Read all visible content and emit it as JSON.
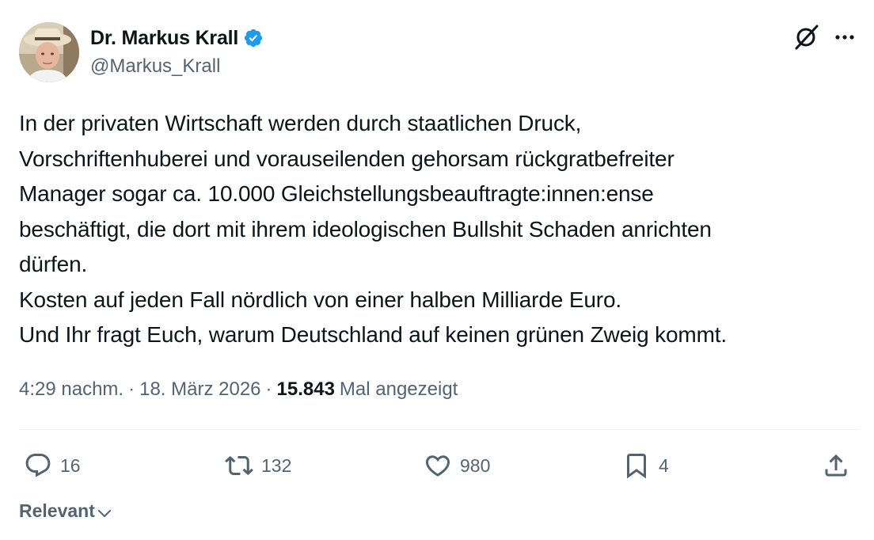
{
  "author": {
    "name": "Dr. Markus Krall",
    "handle": "@Markus_Krall",
    "verified": true
  },
  "tweet": {
    "text": "In der privaten Wirtschaft werden durch staatlichen Druck,\nVorschriftenhuberei und vorauseilenden gehorsam rückgratbefreiter\nManager sogar ca. 10.000 Gleichstellungsbeauftragte:innen:ense\nbeschäftigt, die dort mit ihrem ideologischen Bullshit Schaden anrichten\ndürfen.\nKosten auf jeden Fall nördlich von einer halben Milliarde Euro.\nUnd Ihr fragt Euch, warum Deutschland auf keinen grünen Zweig kommt."
  },
  "meta": {
    "time": "4:29 nachm.",
    "separator": "·",
    "date": "18. März 2026",
    "views_count": "15.843",
    "views_label": "Mal angezeigt"
  },
  "actions": {
    "replies": "16",
    "reposts": "132",
    "likes": "980",
    "bookmarks": "4"
  },
  "sort": {
    "label": "Relevant"
  },
  "icons": {
    "header": [
      "grok-icon",
      "more-icon"
    ],
    "actions": [
      "reply-icon",
      "repost-icon",
      "like-icon",
      "bookmark-icon",
      "share-icon"
    ]
  },
  "colors": {
    "text_primary": "#0f1419",
    "text_secondary": "#536471",
    "verified_blue": "#1d9bf0",
    "divider": "#eff3f4"
  }
}
